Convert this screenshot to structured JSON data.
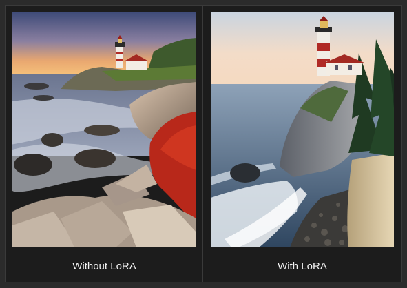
{
  "panels": [
    {
      "caption": "Without LoRA",
      "image": "lighthouse-on-rocky-coast-sunset"
    },
    {
      "caption": "With LoRA",
      "image": "lighthouse-on-cliff-over-sea"
    }
  ]
}
